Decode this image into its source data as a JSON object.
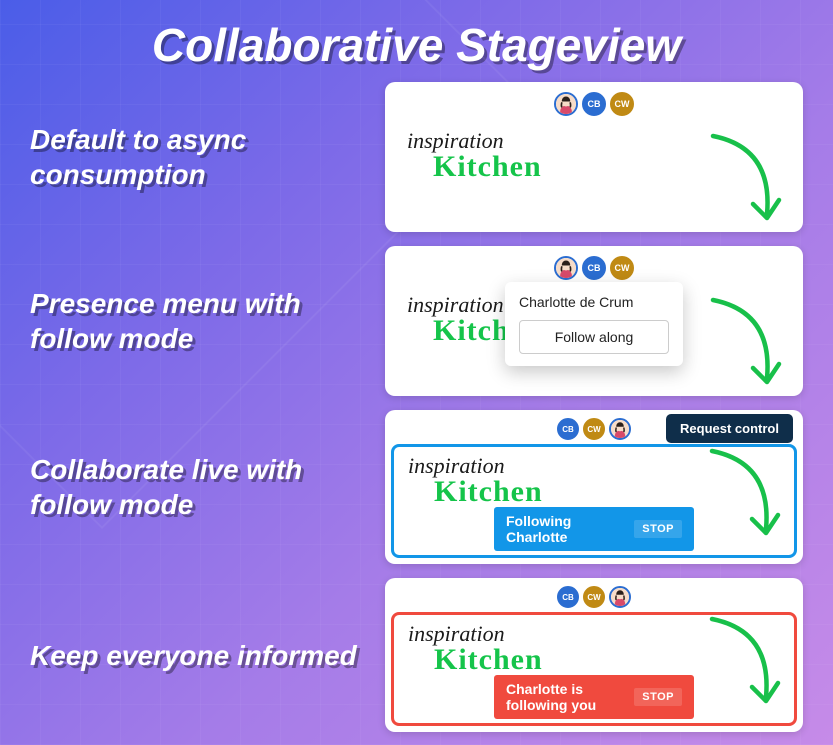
{
  "title": "Collaborative Stageview",
  "rows": {
    "r1": {
      "label": "Default to async consumption"
    },
    "r2": {
      "label": "Presence menu with follow mode",
      "popover": {
        "name": "Charlotte de Crum",
        "button": "Follow along"
      }
    },
    "r3": {
      "label": "Collaborate live with follow mode",
      "request_control": "Request control",
      "status": "Following Charlotte",
      "stop": "STOP"
    },
    "r4": {
      "label": "Keep everyone informed",
      "status": "Charlotte is following you",
      "stop": "STOP"
    }
  },
  "canvas": {
    "word1": "inspiration",
    "word2": "Kitchen"
  },
  "avatars": {
    "cb": "CB",
    "cw": "CW"
  }
}
